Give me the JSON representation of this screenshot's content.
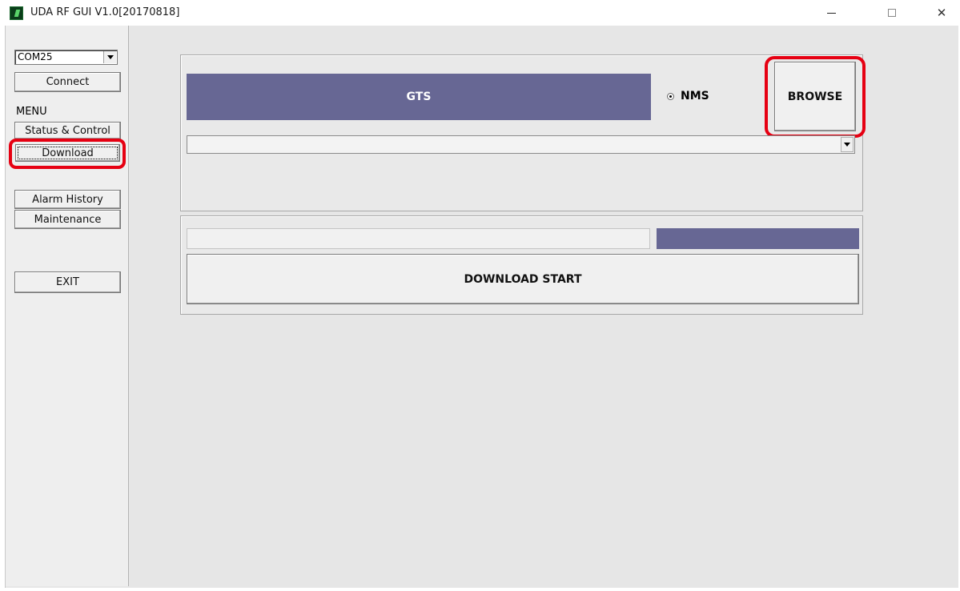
{
  "window": {
    "title": "UDA RF GUI V1.0[20170818]",
    "controls": {
      "minimize": "—",
      "maximize": "☐",
      "close": "✕"
    }
  },
  "sidebar": {
    "port": {
      "value": "COM25"
    },
    "connect_label": "Connect",
    "menu_label": "MENU",
    "items": [
      {
        "label": "Status & Control"
      },
      {
        "label": "Download"
      },
      {
        "label": "Alarm History"
      },
      {
        "label": "Maintenance"
      }
    ],
    "exit_label": "EXIT"
  },
  "download": {
    "target_selected": "GTS",
    "option_label": "NMS",
    "browse_label": "BROWSE",
    "file_path": "",
    "progress_percent": 30,
    "start_label": "DOWNLOAD START"
  },
  "colors": {
    "accent": "#676794",
    "highlight": "#e60012"
  }
}
